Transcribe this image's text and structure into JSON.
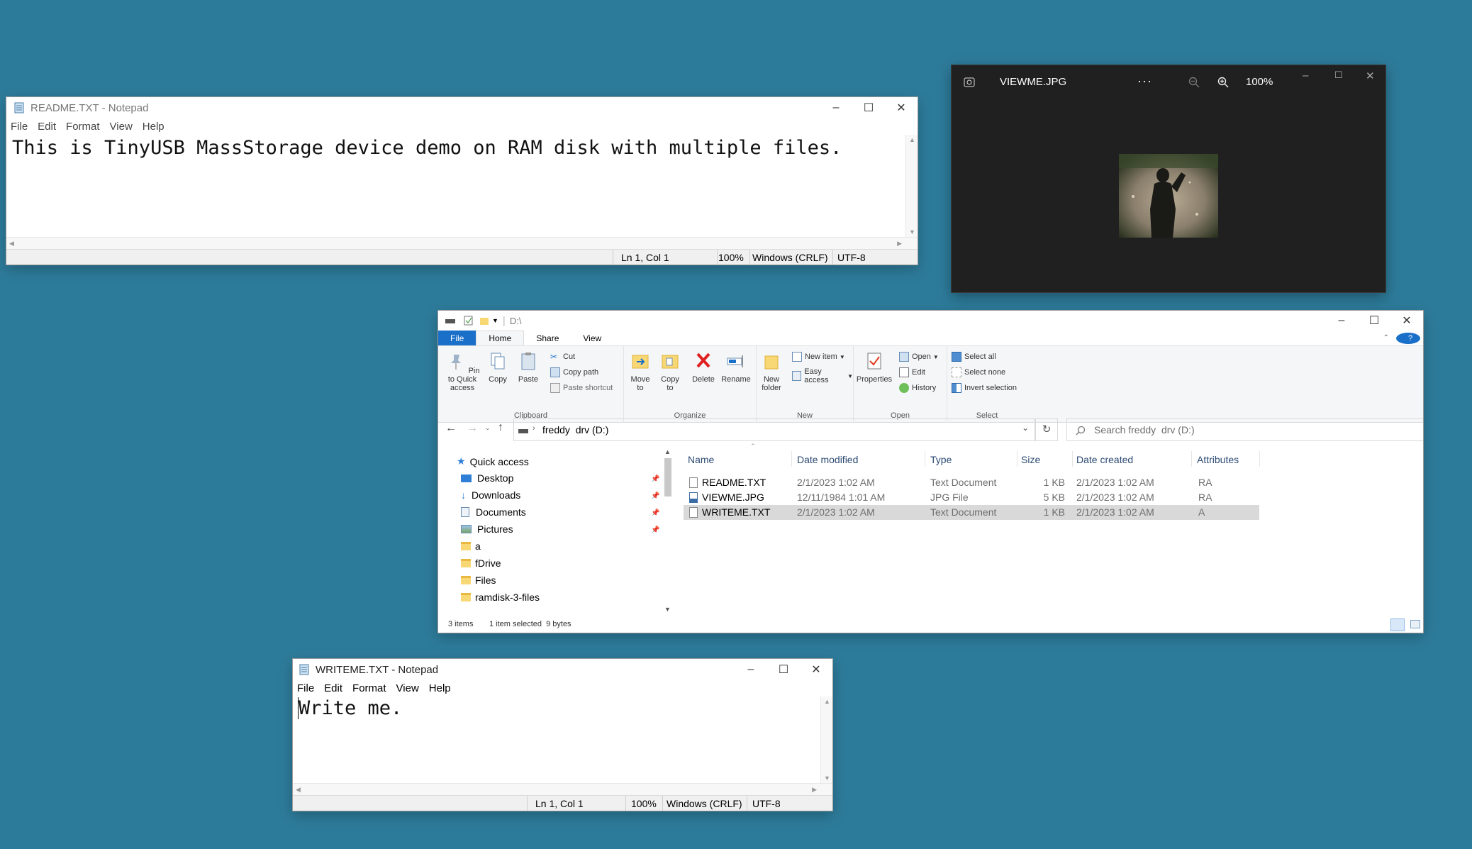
{
  "readme_window": {
    "title": "README.TXT - Notepad",
    "menu": [
      "File",
      "Edit",
      "Format",
      "View",
      "Help"
    ],
    "content": "This is TinyUSB MassStorage device demo on RAM disk with multiple files.",
    "status": {
      "position": "Ln 1, Col 1",
      "zoom": "100%",
      "line_ending": "Windows (CRLF)",
      "encoding": "UTF-8"
    }
  },
  "photo_window": {
    "title": "VIEWME.JPG",
    "more": "···",
    "zoom": "100%"
  },
  "explorer": {
    "title_path": "D:\\",
    "tabs": [
      "File",
      "Home",
      "Share",
      "View"
    ],
    "clipboard": {
      "pin": "Pin to Quick access",
      "copy": "Copy",
      "paste": "Paste",
      "cut": "Cut",
      "copy_path": "Copy path",
      "paste_shortcut": "Paste shortcut",
      "label": "Clipboard"
    },
    "organize": {
      "move_to": "Move to",
      "copy_to": "Copy to",
      "delete": "Delete",
      "rename": "Rename",
      "label": "Organize"
    },
    "new": {
      "new_folder": "New folder",
      "new_item": "New item",
      "easy_access": "Easy access",
      "label": "New"
    },
    "open": {
      "properties": "Properties",
      "open": "Open",
      "edit": "Edit",
      "history": "History",
      "label": "Open"
    },
    "select": {
      "select_all": "Select all",
      "select_none": "Select none",
      "invert": "Invert selection",
      "label": "Select"
    },
    "address": "freddy  drv (D:)",
    "search_placeholder": "Search freddy  drv (D:)",
    "nav": {
      "quick_access": "Quick access",
      "items": [
        "Desktop",
        "Downloads",
        "Documents",
        "Pictures",
        "a",
        "fDrive",
        "Files",
        "ramdisk-3-files"
      ]
    },
    "columns": [
      "Name",
      "Date modified",
      "Type",
      "Size",
      "Date created",
      "Attributes"
    ],
    "files": [
      {
        "name": "README.TXT",
        "modified": "2/1/2023 1:02 AM",
        "type": "Text Document",
        "size": "1 KB",
        "created": "2/1/2023 1:02 AM",
        "attr": "RA"
      },
      {
        "name": "VIEWME.JPG",
        "modified": "12/11/1984 1:01 AM",
        "type": "JPG File",
        "size": "5 KB",
        "created": "2/1/2023 1:02 AM",
        "attr": "RA"
      },
      {
        "name": "WRITEME.TXT",
        "modified": "2/1/2023 1:02 AM",
        "type": "Text Document",
        "size": "1 KB",
        "created": "2/1/2023 1:02 AM",
        "attr": "A"
      }
    ],
    "status": {
      "count": "3 items",
      "selected": "1 item selected  9 bytes"
    }
  },
  "writeme_window": {
    "title": "WRITEME.TXT - Notepad",
    "menu": [
      "File",
      "Edit",
      "Format",
      "View",
      "Help"
    ],
    "content": "Write me.",
    "status": {
      "position": "Ln 1, Col 1",
      "zoom": "100%",
      "line_ending": "Windows (CRLF)",
      "encoding": "UTF-8"
    }
  },
  "colors": {
    "desktop": "#2d7b9a",
    "accent": "#1a6fc9",
    "photo_bg": "#202020"
  }
}
